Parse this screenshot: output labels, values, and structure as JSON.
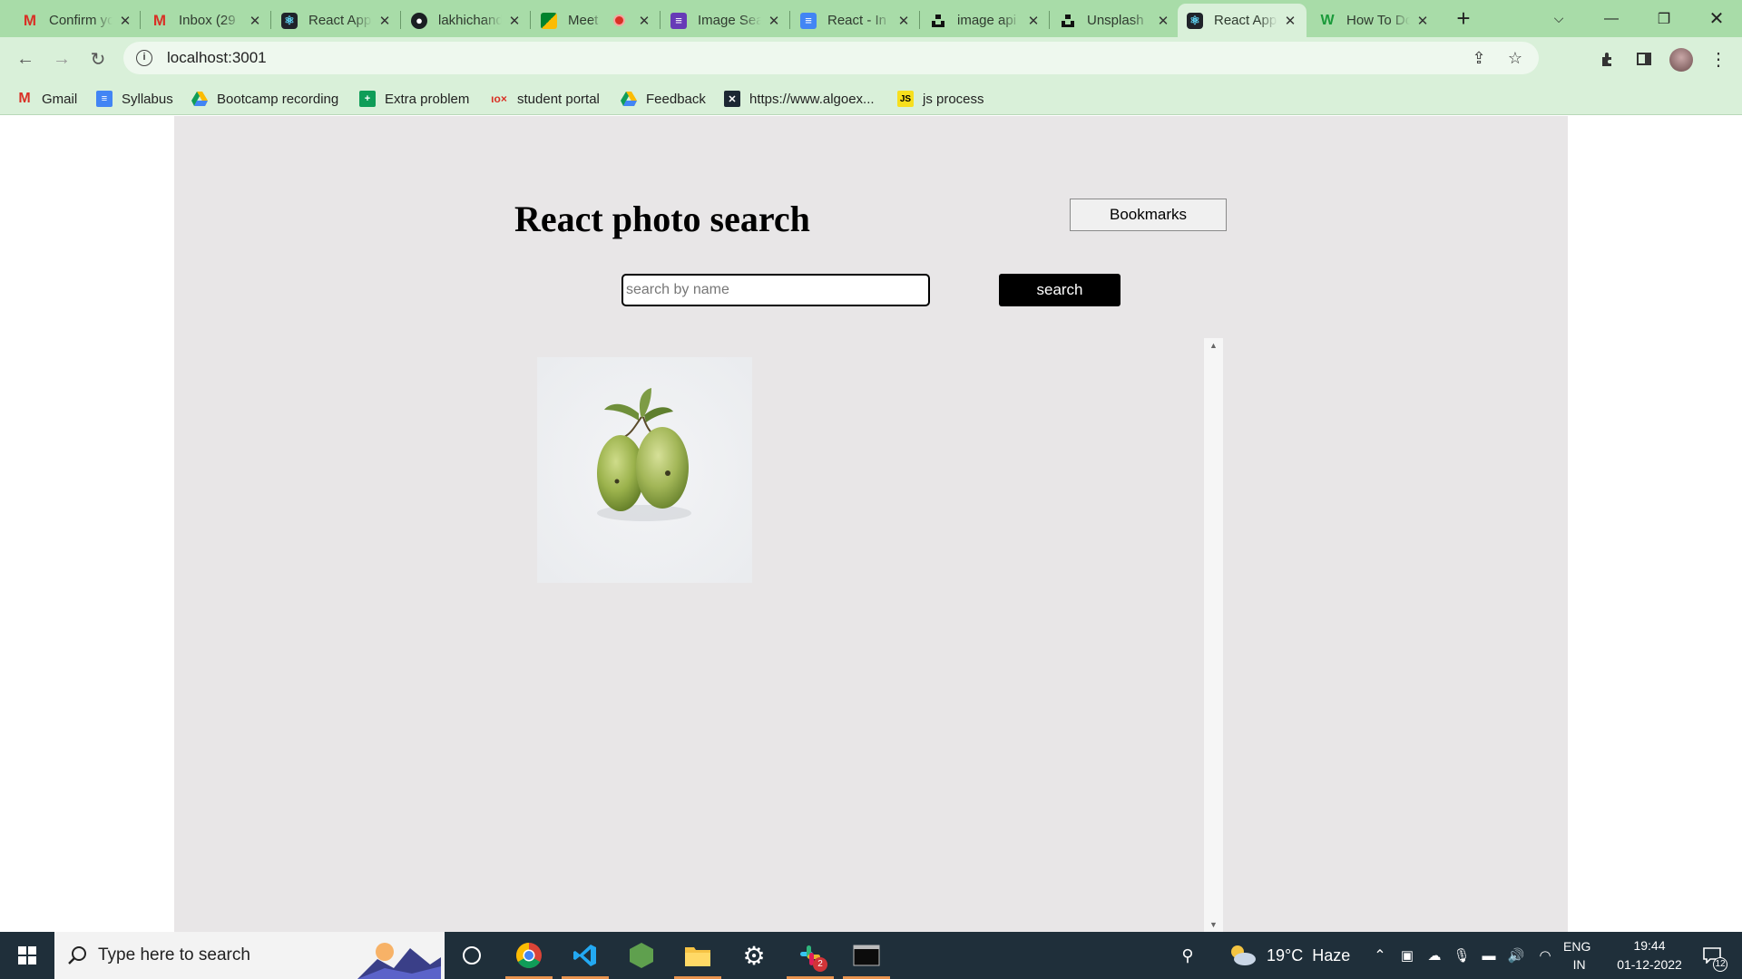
{
  "browser": {
    "tabs": [
      {
        "title": "Confirm your",
        "icon": "gmail-icon",
        "active": false
      },
      {
        "title": "Inbox (29",
        "icon": "gmail-icon",
        "active": false
      },
      {
        "title": "React App",
        "icon": "react-icon",
        "active": false
      },
      {
        "title": "lakhichand",
        "icon": "github-icon",
        "active": false
      },
      {
        "title": "Meet",
        "icon": "meet-icon",
        "active": false
      },
      {
        "title": "Image Search",
        "icon": "forms-icon",
        "active": false
      },
      {
        "title": "React - In",
        "icon": "docs-icon",
        "active": false
      },
      {
        "title": "image api",
        "icon": "unsplash-icon",
        "active": false
      },
      {
        "title": "Unsplash",
        "icon": "unsplash-icon",
        "active": false
      },
      {
        "title": "React App",
        "icon": "react-icon",
        "active": true
      },
      {
        "title": "How To Do",
        "icon": "wix-icon",
        "active": false
      }
    ],
    "address": "localhost:3001",
    "bookmarks": [
      {
        "label": "Gmail",
        "icon": "gmail-icon"
      },
      {
        "label": "Syllabus",
        "icon": "docs-icon"
      },
      {
        "label": "Bootcamp recording",
        "icon": "drive-icon"
      },
      {
        "label": "Extra problem",
        "icon": "sheets-icon"
      },
      {
        "label": "student portal",
        "icon": "portal-icon"
      },
      {
        "label": "Feedback",
        "icon": "drive-icon"
      },
      {
        "label": "https://www.algoex...",
        "icon": "algoexpert-icon"
      },
      {
        "label": "js process",
        "icon": "js-icon"
      }
    ]
  },
  "app": {
    "title": "React photo search",
    "bookmarks_label": "Bookmarks",
    "search": {
      "placeholder": "search by name",
      "value": "",
      "button_label": "search"
    },
    "results": [
      {
        "alt": "two green guavas with leaves",
        "subject": "guava"
      }
    ]
  },
  "taskbar": {
    "search_placeholder": "Type here to search",
    "pinned_apps": [
      "cortana-icon",
      "chrome-icon",
      "vscode-icon",
      "nodejs-icon",
      "file-explorer-icon",
      "settings-icon",
      "slack-icon",
      "terminal-icon"
    ],
    "slack_badge": "2",
    "weather": "19°C  Haze",
    "language": "ENG",
    "region": "IN",
    "time": "19:44",
    "date": "01-12-2022",
    "notification_count": "12"
  }
}
